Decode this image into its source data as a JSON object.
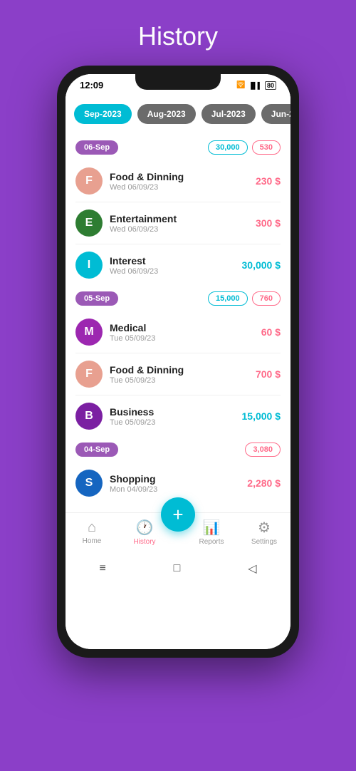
{
  "pageTitle": "History",
  "statusBar": {
    "time": "12:09",
    "icons": "📶🔋"
  },
  "monthTabs": [
    {
      "label": "Sep-2023",
      "active": true
    },
    {
      "label": "Aug-2023",
      "active": false
    },
    {
      "label": "Jul-2023",
      "active": false
    },
    {
      "label": "Jun-2",
      "active": false
    }
  ],
  "sections": [
    {
      "date": "06-Sep",
      "income": "30,000",
      "expense": "530",
      "transactions": [
        {
          "initial": "F",
          "color": "#E8A090",
          "name": "Food & Dinning",
          "date": "Wed 06/09/23",
          "amount": "230 $",
          "type": "expense"
        },
        {
          "initial": "E",
          "color": "#2E7D32",
          "name": "Entertainment",
          "date": "Wed 06/09/23",
          "amount": "300 $",
          "type": "expense"
        },
        {
          "initial": "I",
          "color": "#00BCD4",
          "name": "Interest",
          "date": "Wed 06/09/23",
          "amount": "30,000 $",
          "type": "income"
        }
      ]
    },
    {
      "date": "05-Sep",
      "income": "15,000",
      "expense": "760",
      "transactions": [
        {
          "initial": "M",
          "color": "#9C27B0",
          "name": "Medical",
          "date": "Tue 05/09/23",
          "amount": "60 $",
          "type": "expense"
        },
        {
          "initial": "F",
          "color": "#E8A090",
          "name": "Food & Dinning",
          "date": "Tue 05/09/23",
          "amount": "700 $",
          "type": "expense"
        },
        {
          "initial": "B",
          "color": "#7B1FA2",
          "name": "Business",
          "date": "Tue 05/09/23",
          "amount": "15,000 $",
          "type": "income"
        }
      ]
    },
    {
      "date": "04-Sep",
      "income": null,
      "expense": "3,080",
      "transactions": [
        {
          "initial": "S",
          "color": "#1565C0",
          "name": "Shopping",
          "date": "Mon 04/09/23",
          "amount": "2,280 $",
          "type": "expense"
        }
      ]
    }
  ],
  "bottomNav": {
    "items": [
      {
        "label": "Home",
        "active": false
      },
      {
        "label": "History",
        "active": true
      },
      {
        "label": "Reports",
        "active": false
      },
      {
        "label": "Settings",
        "active": false
      }
    ],
    "fabLabel": "+"
  }
}
